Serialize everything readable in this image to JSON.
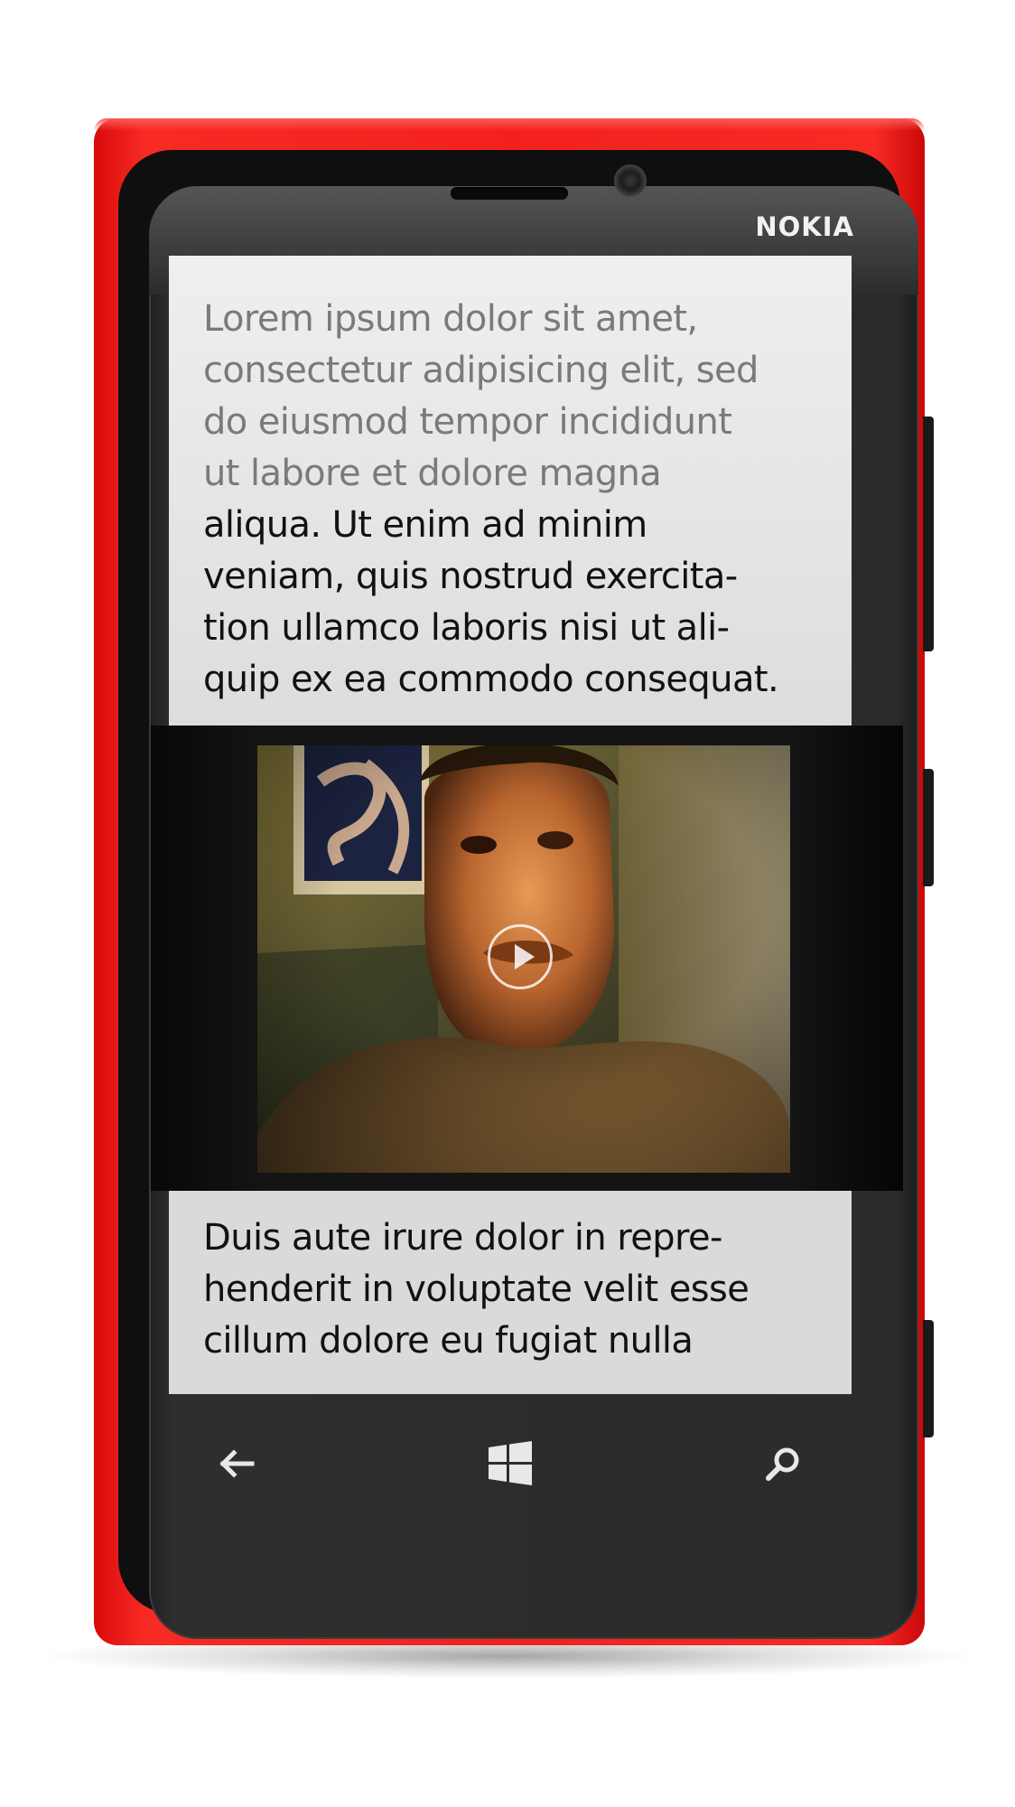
{
  "device": {
    "brand": "NOKIA",
    "body_color": "#f3211e"
  },
  "content": {
    "top_paragraph_faded_lines": [
      "Lorem ipsum dolor sit amet,",
      "consectetur adipisicing elit, sed",
      "do eiusmod tempor incididunt",
      "ut labore et dolore magna"
    ],
    "top_paragraph_lines": [
      "aliqua. Ut enim ad minim",
      "veniam, quis nostrud exercita-",
      "tion ullamco laboris nisi ut ali-",
      "quip ex ea commodo consequat."
    ],
    "bottom_paragraph_lines": [
      "Duis aute irure dolor in repre-",
      "henderit in voluptate velit esse",
      "cillum dolore eu fugiat nulla"
    ],
    "faded_text_color": "#7a7a7a",
    "text_color": "#111111"
  },
  "video": {
    "thumbnail": "video-thumbnail-man-portrait",
    "play_icon": "play-icon"
  },
  "navbar": {
    "back_icon": "back-arrow-icon",
    "start_icon": "windows-start-icon",
    "search_icon": "search-icon"
  }
}
